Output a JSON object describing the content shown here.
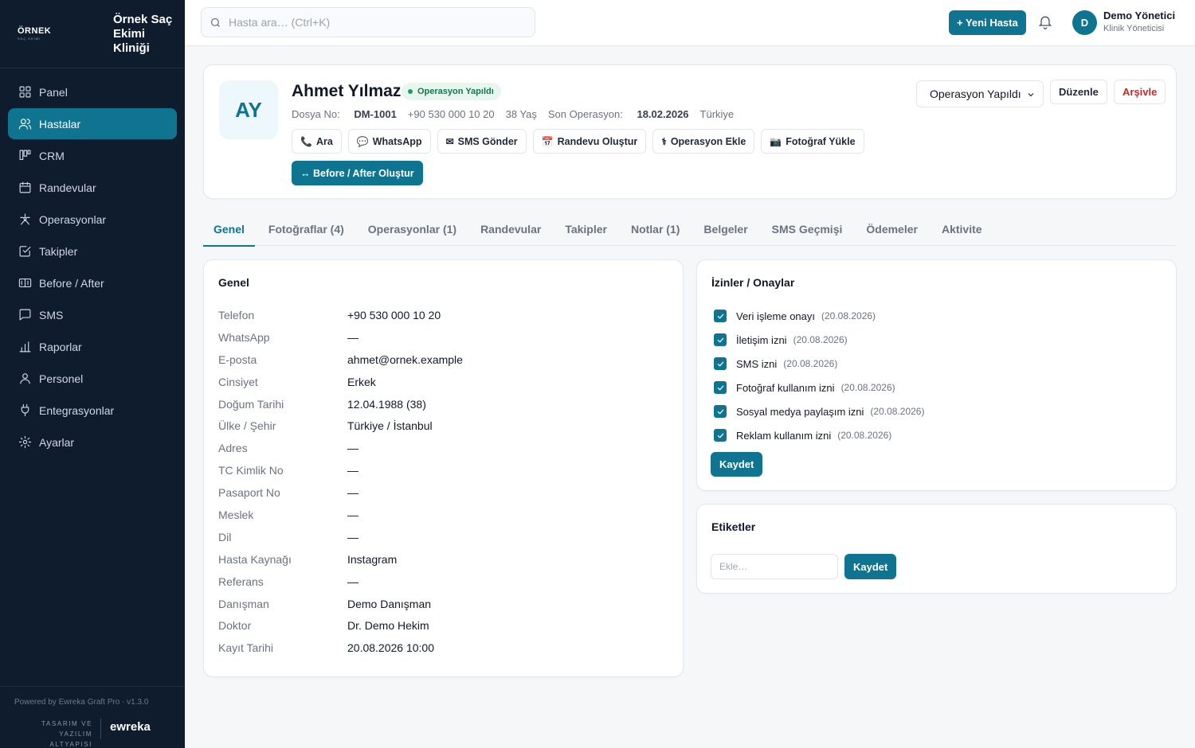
{
  "brand": {
    "logo_line1": "ÖRNEK",
    "logo_line2": "SAÇ EKİMİ",
    "title": "Örnek Saç Ekimi Kliniği"
  },
  "sidebar": {
    "items": [
      {
        "label": "Panel",
        "icon": "grid-icon"
      },
      {
        "label": "Hastalar",
        "icon": "users-icon",
        "active": true
      },
      {
        "label": "CRM",
        "icon": "kanban-icon"
      },
      {
        "label": "Randevular",
        "icon": "calendar-icon"
      },
      {
        "label": "Operasyonlar",
        "icon": "scissors-icon"
      },
      {
        "label": "Takipler",
        "icon": "checklist-icon"
      },
      {
        "label": "Before / After",
        "icon": "compare-icon"
      },
      {
        "label": "SMS",
        "icon": "message-icon"
      },
      {
        "label": "Raporlar",
        "icon": "bar-chart-icon"
      },
      {
        "label": "Personel",
        "icon": "person-icon"
      },
      {
        "label": "Entegrasyonlar",
        "icon": "plug-icon"
      },
      {
        "label": "Ayarlar",
        "icon": "gear-icon"
      }
    ],
    "footer": {
      "powered": "Powered by Ewreka Graft Pro · v1.3.0",
      "design_line1": "TASARIM VE",
      "design_line2": "YAZILIM ALTYAPISI",
      "brand": "ewreka"
    }
  },
  "topbar": {
    "search_placeholder": "Hasta ara… (Ctrl+K)",
    "new_patient": "+ Yeni Hasta",
    "user_initial": "D",
    "user_name": "Demo Yönetici",
    "user_role": "Klinik Yöneticisi"
  },
  "patient": {
    "initials": "AY",
    "name": "Ahmet Yılmaz",
    "status": "Operasyon Yapıldı",
    "file_label": "Dosya No:",
    "file_no": "DM-1001",
    "phone": "+90 530 000 10 20",
    "age": "38 Yaş",
    "last_op_label": "Son Operasyon:",
    "last_op_date": "18.02.2026",
    "country": "Türkiye",
    "actions": [
      {
        "icon": "📞",
        "label": "Ara"
      },
      {
        "icon": "💬",
        "label": "WhatsApp"
      },
      {
        "icon": "✉",
        "label": "SMS Gönder"
      },
      {
        "icon": "📅",
        "label": "Randevu Oluştur"
      },
      {
        "icon": "⚕",
        "label": "Operasyon Ekle"
      },
      {
        "icon": "📷",
        "label": "Fotoğraf Yükle"
      }
    ],
    "before_after": "↔ Before / After Oluştur",
    "status_select": "Operasyon Yapıldı",
    "edit": "Düzenle",
    "archive": "Arşivle"
  },
  "tabs": [
    "Genel",
    "Fotoğraflar (4)",
    "Operasyonlar (1)",
    "Randevular",
    "Takipler",
    "Notlar (1)",
    "Belgeler",
    "SMS Geçmişi",
    "Ödemeler",
    "Aktivite"
  ],
  "general": {
    "title": "Genel",
    "rows": [
      {
        "key": "Telefon",
        "value": "+90 530 000 10 20"
      },
      {
        "key": "WhatsApp",
        "value": "—"
      },
      {
        "key": "E-posta",
        "value": "ahmet@ornek.example"
      },
      {
        "key": "Cinsiyet",
        "value": "Erkek"
      },
      {
        "key": "Doğum Tarihi",
        "value": "12.04.1988 (38)"
      },
      {
        "key": "Ülke / Şehir",
        "value": "Türkiye / İstanbul"
      },
      {
        "key": "Adres",
        "value": "—"
      },
      {
        "key": "TC Kimlik No",
        "value": "—"
      },
      {
        "key": "Pasaport No",
        "value": "—"
      },
      {
        "key": "Meslek",
        "value": "—"
      },
      {
        "key": "Dil",
        "value": "—"
      },
      {
        "key": "Hasta Kaynağı",
        "value": "Instagram"
      },
      {
        "key": "Referans",
        "value": "—"
      },
      {
        "key": "Danışman",
        "value": "Demo Danışman"
      },
      {
        "key": "Doktor",
        "value": "Dr. Demo Hekim"
      },
      {
        "key": "Kayıt Tarihi",
        "value": "20.08.2026 10:00"
      }
    ]
  },
  "consents": {
    "title": "İzinler / Onaylar",
    "items": [
      {
        "label": "Veri işleme onayı",
        "date": "(20.08.2026)",
        "checked": true
      },
      {
        "label": "İletişim izni",
        "date": "(20.08.2026)",
        "checked": true
      },
      {
        "label": "SMS izni",
        "date": "(20.08.2026)",
        "checked": true
      },
      {
        "label": "Fotoğraf kullanım izni",
        "date": "(20.08.2026)",
        "checked": true
      },
      {
        "label": "Sosyal medya paylaşım izni",
        "date": "(20.08.2026)",
        "checked": true
      },
      {
        "label": "Reklam kullanım izni",
        "date": "(20.08.2026)",
        "checked": true
      }
    ],
    "save": "Kaydet"
  },
  "tags": {
    "title": "Etiketler",
    "placeholder": "Ekle…",
    "save": "Kaydet"
  },
  "colors": {
    "accent": "#0e7490",
    "sidebar_bg": "#0f1c2e",
    "danger": "#c62828",
    "success": "#0f7a4f"
  }
}
